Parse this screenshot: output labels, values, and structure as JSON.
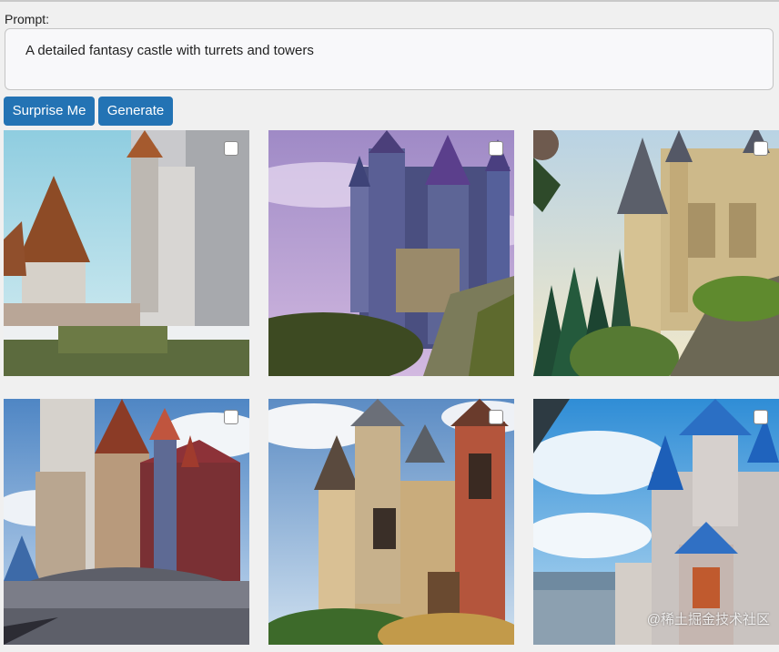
{
  "prompt": {
    "label": "Prompt:",
    "value": "A detailed fantasy castle with turrets and towers"
  },
  "buttons": {
    "surprise_label": "Surprise Me",
    "generate_label": "Generate",
    "color": "#2373b4"
  },
  "images": [
    {
      "subject": "white stone castle with brown conical roofs, snowy ledge",
      "checked": false
    },
    {
      "subject": "purple fairytale castle with blue spires on a cliff",
      "checked": false
    },
    {
      "subject": "golden cathedral-like castle among pine trees",
      "checked": false
    },
    {
      "subject": "painted castle with red and blue turrets, round wall",
      "checked": false
    },
    {
      "subject": "stone castle with grey spires and red brick tower",
      "checked": false
    },
    {
      "subject": "white castle with bright blue spires, mountain view",
      "checked": false
    }
  ],
  "watermark": "@稀土掘金技术社区"
}
